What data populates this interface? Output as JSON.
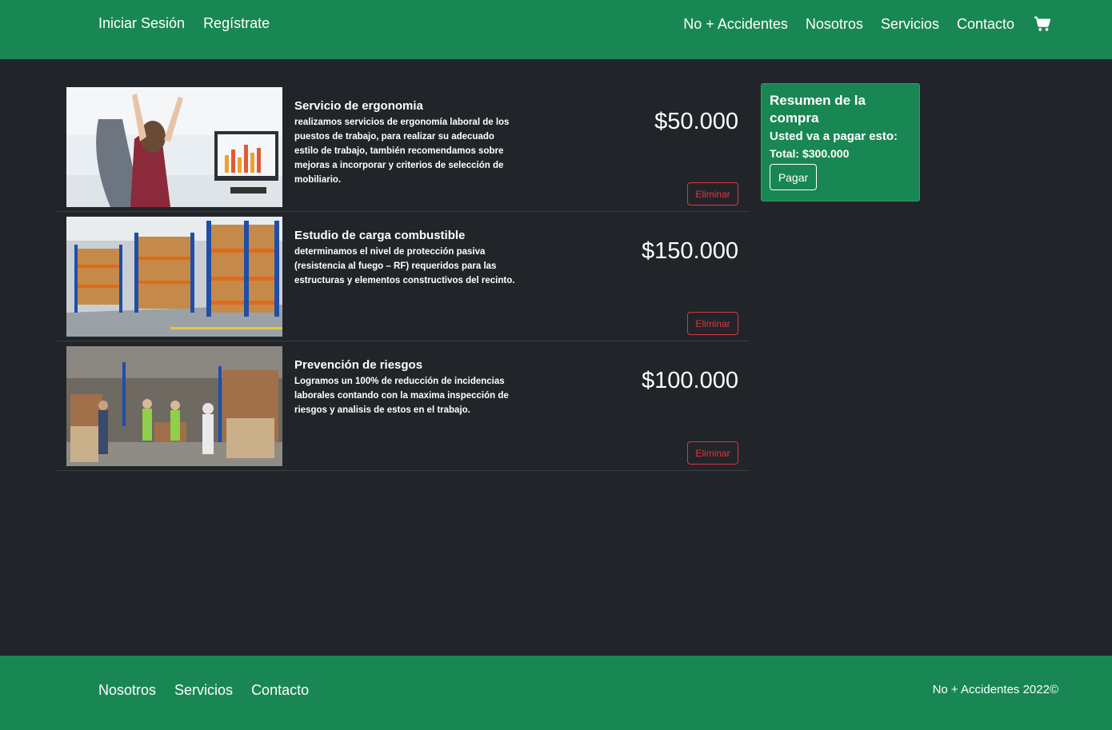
{
  "header": {
    "left_links": [
      "Iniciar Sesión",
      "Regístrate"
    ],
    "right_links": [
      "No + Accidentes",
      "Nosotros",
      "Servicios",
      "Contacto"
    ],
    "cart_icon": "shopping-cart-icon"
  },
  "cart": {
    "items": [
      {
        "title": "Servicio de ergonomia",
        "description": "realizamos servicios de ergonomía laboral de los puestos de trabajo, para realizar su adecuado estilo de trabajo, también recomendamos sobre mejoras a incorporar y criterios de selección de mobiliario.",
        "price": "$50.000",
        "remove_label": "Eliminar"
      },
      {
        "title": "Estudio de carga combustible",
        "description": "determinamos el nivel de protección pasiva (resistencia al fuego – RF) requeridos para las estructuras y elementos constructivos del recinto.",
        "price": "$150.000",
        "remove_label": "Eliminar"
      },
      {
        "title": "Prevención de riesgos",
        "description": "Logramos un 100% de reducción de incidencias laborales contando con la maxima inspección de riesgos y analisis de estos en el trabajo.",
        "price": "$100.000",
        "remove_label": "Eliminar"
      }
    ]
  },
  "summary": {
    "title": "Resumen de la compra",
    "subtitle": "Usted va a pagar esto:",
    "total_label": "Total:",
    "total_value": "$300.000",
    "pay_label": "Pagar"
  },
  "footer": {
    "links": [
      "Nosotros",
      "Servicios",
      "Contacto"
    ],
    "copyright": "No + Accidentes 2022©"
  },
  "colors": {
    "brand_green": "#198754",
    "background": "#212529",
    "danger": "#dc3545"
  }
}
